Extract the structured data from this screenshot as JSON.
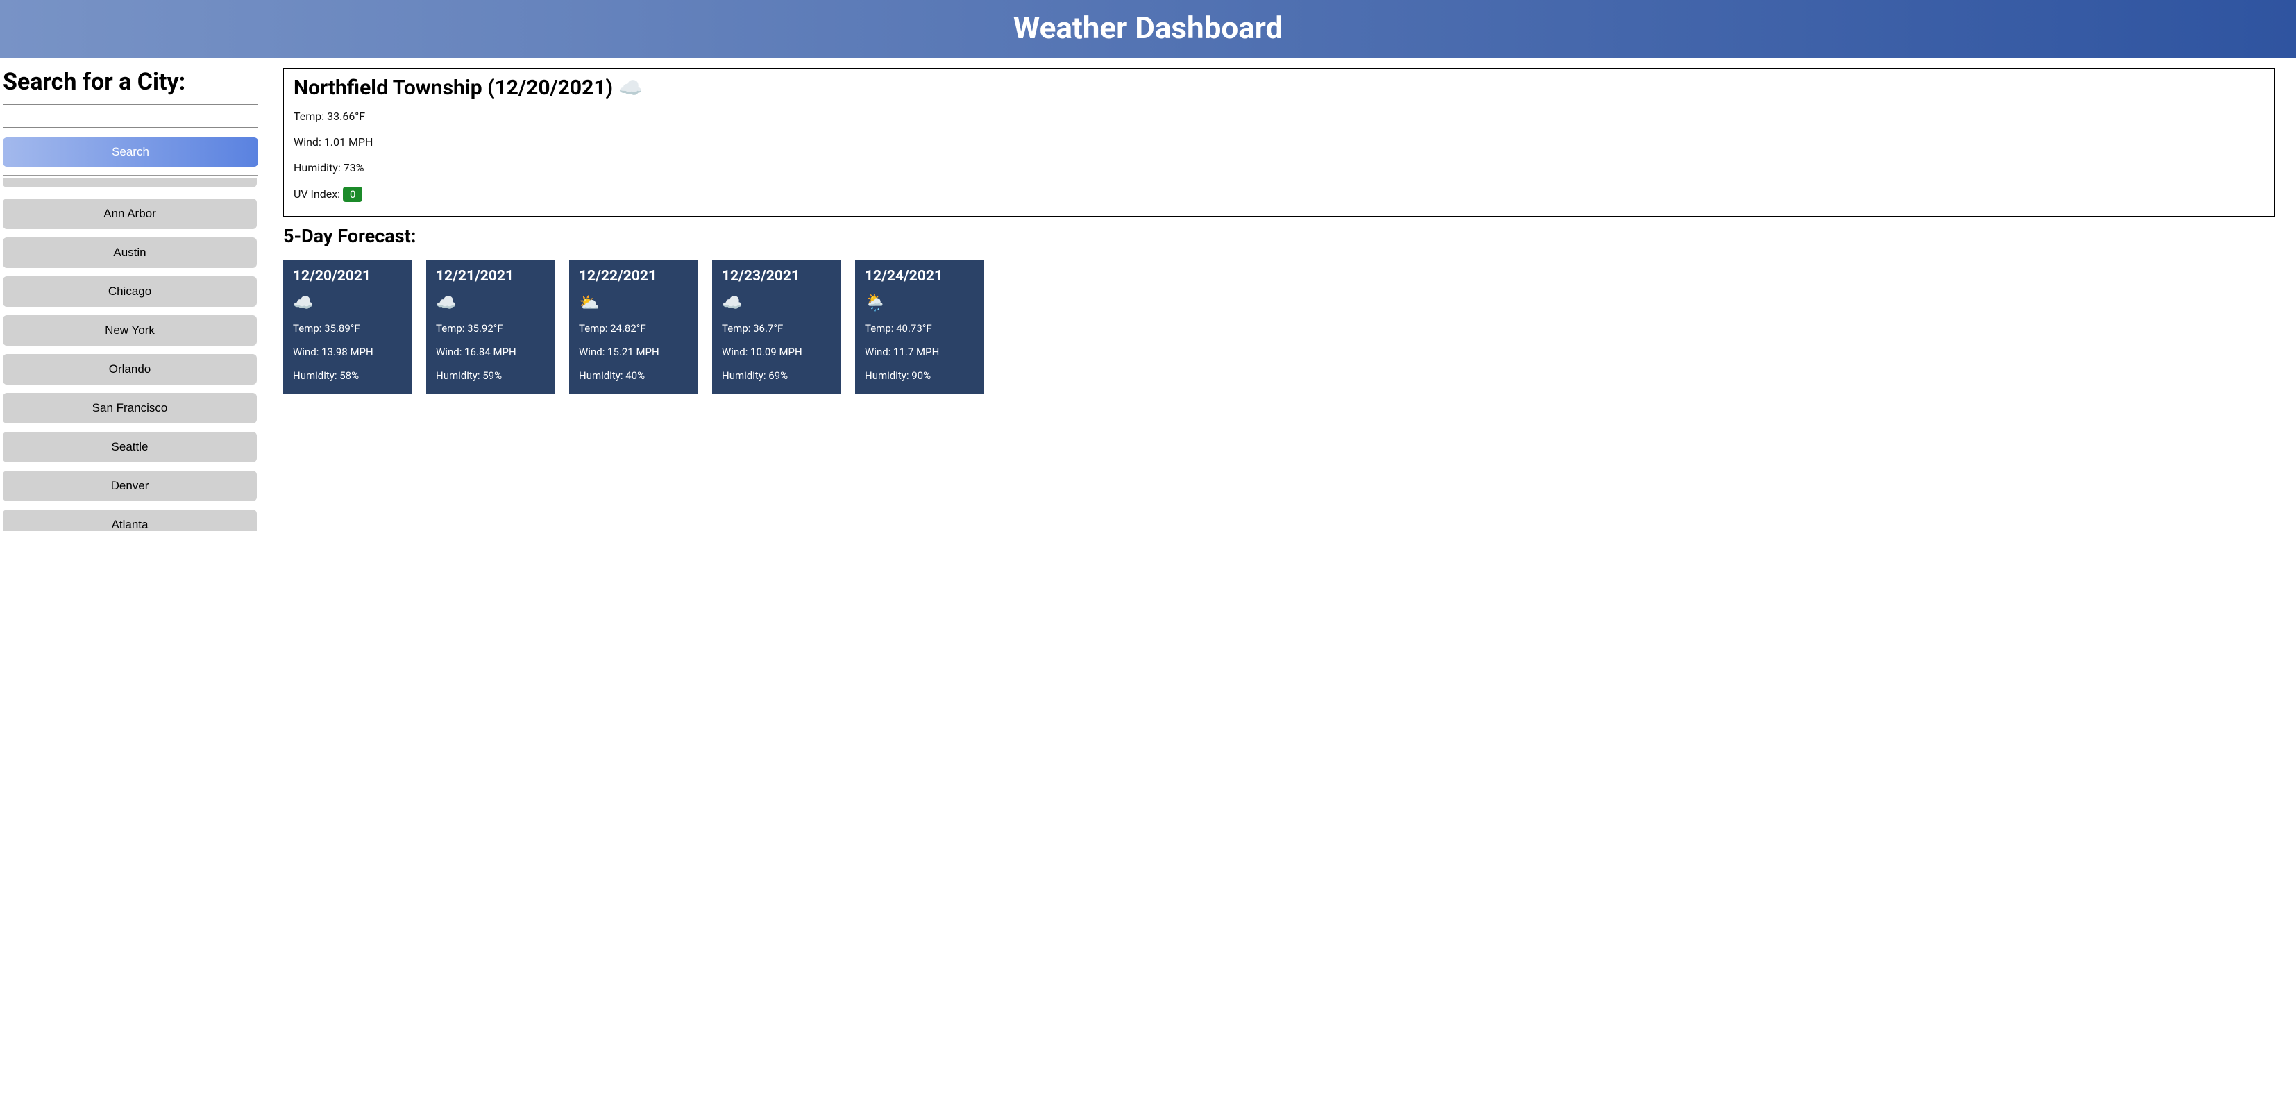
{
  "header": {
    "title": "Weather Dashboard"
  },
  "sidebar": {
    "search_heading": "Search for a City:",
    "search_value": "",
    "search_button": "Search",
    "history": [
      "Ann Arbor",
      "Austin",
      "Chicago",
      "New York",
      "Orlando",
      "San Francisco",
      "Seattle",
      "Denver",
      "Atlanta"
    ]
  },
  "current": {
    "city": "Northfield Township",
    "date": "12/20/2021",
    "title_text": "Northfield Township (12/20/2021)",
    "icon": "cloud-night-icon",
    "temp_label": "Temp: 33.66°F",
    "wind_label": "Wind: 1.01 MPH",
    "humidity_label": "Humidity: 73%",
    "uv_label": "UV Index: ",
    "uv_value": "0",
    "uv_color": "#1b8a29"
  },
  "forecast": {
    "heading": "5-Day Forecast:",
    "days": [
      {
        "date": "12/20/2021",
        "icon": "cloud-night-icon",
        "icon_glyph": "☁️",
        "temp": "Temp: 35.89°F",
        "wind": "Wind: 13.98 MPH",
        "humidity": "Humidity: 58%"
      },
      {
        "date": "12/21/2021",
        "icon": "cloud-icon",
        "icon_glyph": "☁️",
        "temp": "Temp: 35.92°F",
        "wind": "Wind: 16.84 MPH",
        "humidity": "Humidity: 59%"
      },
      {
        "date": "12/22/2021",
        "icon": "partly-cloudy-day-icon",
        "icon_glyph": "⛅",
        "temp": "Temp: 24.82°F",
        "wind": "Wind: 15.21 MPH",
        "humidity": "Humidity: 40%"
      },
      {
        "date": "12/23/2021",
        "icon": "cloud-night-icon",
        "icon_glyph": "☁️",
        "temp": "Temp: 36.7°F",
        "wind": "Wind: 10.09 MPH",
        "humidity": "Humidity: 69%"
      },
      {
        "date": "12/24/2021",
        "icon": "rain-sun-icon",
        "icon_glyph": "🌦️",
        "temp": "Temp: 40.73°F",
        "wind": "Wind: 11.7 MPH",
        "humidity": "Humidity: 90%"
      }
    ]
  }
}
